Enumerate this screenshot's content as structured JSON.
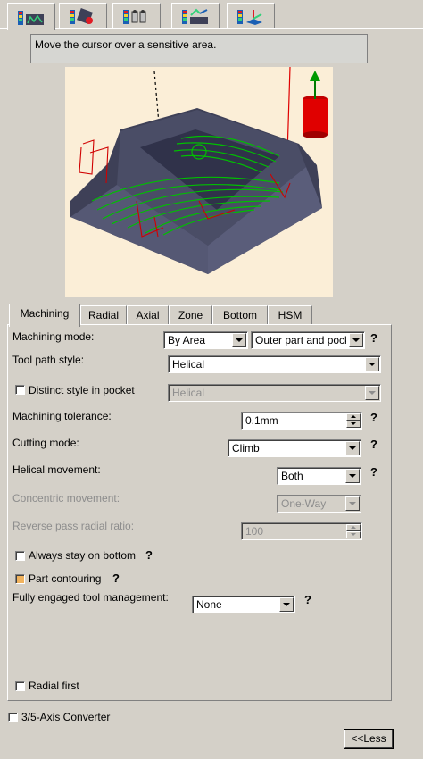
{
  "top_tabs": [
    {
      "icon": "strategy-parameters-icon"
    },
    {
      "icon": "tool-parameters-icon"
    },
    {
      "icon": "feeds-speeds-icon"
    },
    {
      "icon": "macro-data-icon"
    },
    {
      "icon": "geometry-icon"
    }
  ],
  "message": "Move the cursor over a sensitive area.",
  "tabs": [
    "Machining",
    "Radial",
    "Axial",
    "Zone",
    "Bottom",
    "HSM"
  ],
  "form": {
    "machining_mode_label": "Machining mode:",
    "machining_mode_value": "By Area",
    "machining_mode_value2": "Outer part and pock",
    "tool_path_style_label": "Tool path style:",
    "tool_path_style_value": "Helical",
    "distinct_style_label": "Distinct style in pocket",
    "distinct_style_value": "Helical",
    "machining_tolerance_label": "Machining tolerance:",
    "machining_tolerance_value": "0.1mm",
    "cutting_mode_label": "Cutting mode:",
    "cutting_mode_value": "Climb",
    "helical_movement_label": "Helical movement:",
    "helical_movement_value": "Both",
    "concentric_movement_label": "Concentric movement:",
    "concentric_movement_value": "One-Way",
    "reverse_pass_label": "Reverse pass radial ratio:",
    "reverse_pass_value": "100",
    "always_stay_label": "Always stay on bottom",
    "part_contouring_label": "Part contouring",
    "fully_engaged_label": "Fully engaged tool management:",
    "fully_engaged_value": "None",
    "radial_first_label": "Radial first",
    "help": "?"
  },
  "converter_label": "3/5-Axis Converter",
  "less_button": "<<Less",
  "colors": {
    "background": "#d4d0c8",
    "preview_bg": "#fbeed7",
    "part": "#3e4057",
    "toolpath_green": "#00c000",
    "toolpath_red": "#d00000",
    "tool": "#e00000",
    "arrow": "#009900",
    "checkbox_on": "#f1b35d"
  }
}
